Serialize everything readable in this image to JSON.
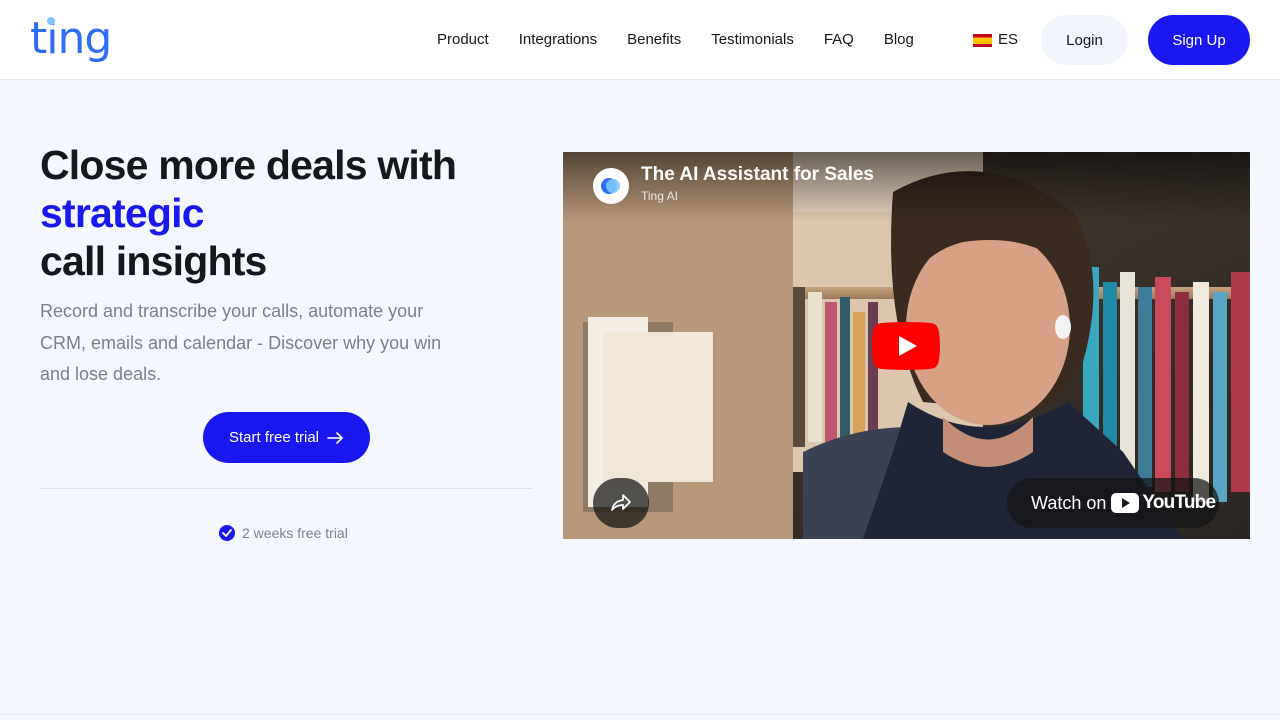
{
  "header": {
    "logo_text": "ting",
    "nav": [
      "Product",
      "Integrations",
      "Benefits",
      "Testimonials",
      "FAQ",
      "Blog"
    ],
    "language": "ES",
    "login_label": "Login",
    "signup_label": "Sign Up"
  },
  "hero": {
    "headline_line1": "Close more deals with",
    "headline_accent": "strategic",
    "headline_line3": "call insights",
    "subtext": "Record and transcribe your calls, automate your CRM, emails and calendar - Discover why you win and lose deals.",
    "cta_label": "Start free trial",
    "trial_note": "2 weeks free trial"
  },
  "video": {
    "title": "The AI Assistant for Sales",
    "channel": "Ting AI",
    "watch_on_label": "Watch on",
    "youtube_label": "YouTube"
  },
  "colors": {
    "brand_blue": "#1a18f0",
    "logo_blue": "#2d6df6",
    "youtube_red": "#ff0000"
  },
  "icons": {
    "flag": "spain-flag-icon",
    "cta_arrow": "arrow-right-icon",
    "check": "check-circle-icon",
    "play": "youtube-play-icon",
    "share": "share-icon"
  }
}
